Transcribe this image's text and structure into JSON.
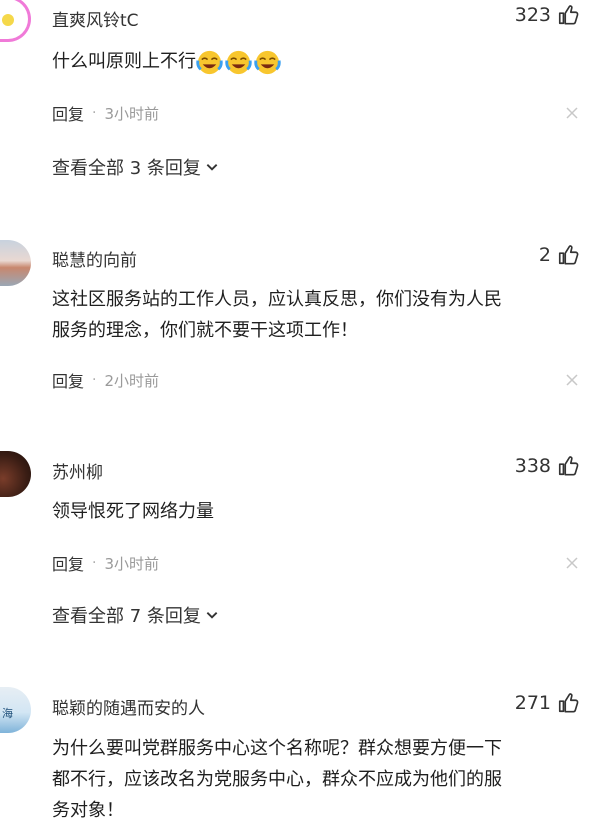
{
  "comments": [
    {
      "username": "直爽风铃tC",
      "likes": "323",
      "text": "什么叫原则上不行",
      "emojis": [
        "crying-laugh-icon",
        "crying-laugh-icon",
        "crying-laugh-icon"
      ],
      "reply_label": "回复",
      "separator": "·",
      "time": "3小时前",
      "view_all": "查看全部 3 条回复"
    },
    {
      "username": "聪慧的向前",
      "likes": "2",
      "text_line1": "这社区服务站的工作人员，应认真反思，你们没有为人民",
      "text_line2": "服务的理念，你们就不要干这项工作！",
      "reply_label": "回复",
      "separator": "·",
      "time": "2小时前"
    },
    {
      "username": "苏州柳",
      "likes": "338",
      "text": "领导恨死了网络力量",
      "reply_label": "回复",
      "separator": "·",
      "time": "3小时前",
      "view_all": "查看全部 7 条回复"
    },
    {
      "username": "聪颖的随遇而安的人",
      "likes": "271",
      "text_line1": "为什么要叫党群服务中心这个名称呢？群众想要方便一下",
      "text_line2": "都不行，应该改名为党服务中心，群众不应成为他们的服",
      "text_line3": "务对象！",
      "avatar_text": "海"
    }
  ],
  "colors": {
    "text": "#222222",
    "muted": "#9a9a9a",
    "avatar_ring": "#f07ad8"
  }
}
